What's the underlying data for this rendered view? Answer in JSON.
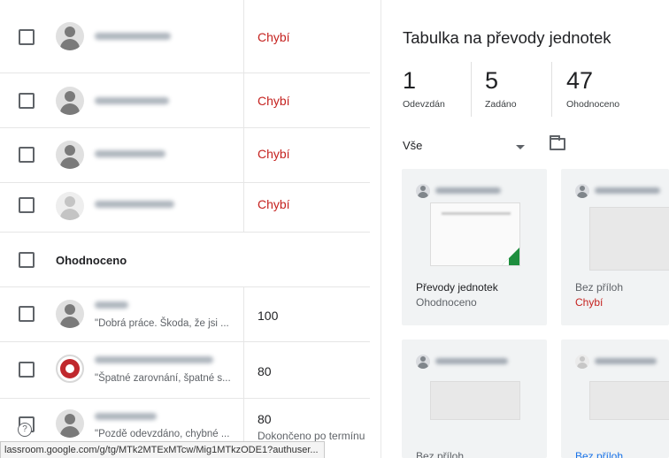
{
  "students": [
    {
      "status": "Chybí"
    },
    {
      "status": "Chybí"
    },
    {
      "status": "Chybí"
    },
    {
      "status": "Chybí"
    }
  ],
  "section": {
    "label": "Ohodnoceno"
  },
  "graded": [
    {
      "comment": "\"Dobrá práce. Škoda, že jsi ...",
      "grade": "100",
      "note": ""
    },
    {
      "comment": "\"Špatné zarovnání, špatné s...",
      "grade": "80",
      "note": ""
    },
    {
      "comment": "\"Pozdě odevzdáno, chybné ...",
      "grade": "80",
      "note": "Dokončeno po termínu"
    }
  ],
  "panel": {
    "title": "Tabulka na převody jednotek",
    "stats": [
      {
        "num": "1",
        "label": "Odevzdán"
      },
      {
        "num": "5",
        "label": "Zadáno"
      },
      {
        "num": "47",
        "label": "Ohodnoceno"
      }
    ],
    "filter": "Vše",
    "cards": [
      {
        "title": "Převody jednotek",
        "sub": "Ohodnoceno"
      },
      {
        "title": "Bez příloh",
        "sub": "Chybí"
      },
      {
        "title": "Bez příloh",
        "sub": ""
      },
      {
        "title": "Bez příloh",
        "sub": ""
      }
    ]
  },
  "statusbar": {
    "url": "lassroom.google.com/g/tg/MTk2MTExMTcw/Mig1MTkzODE1?authuser..."
  },
  "colors": {
    "missing": "#c5221f",
    "graded_link": "#1a73e8",
    "accent_green": "#1e8e3e"
  }
}
